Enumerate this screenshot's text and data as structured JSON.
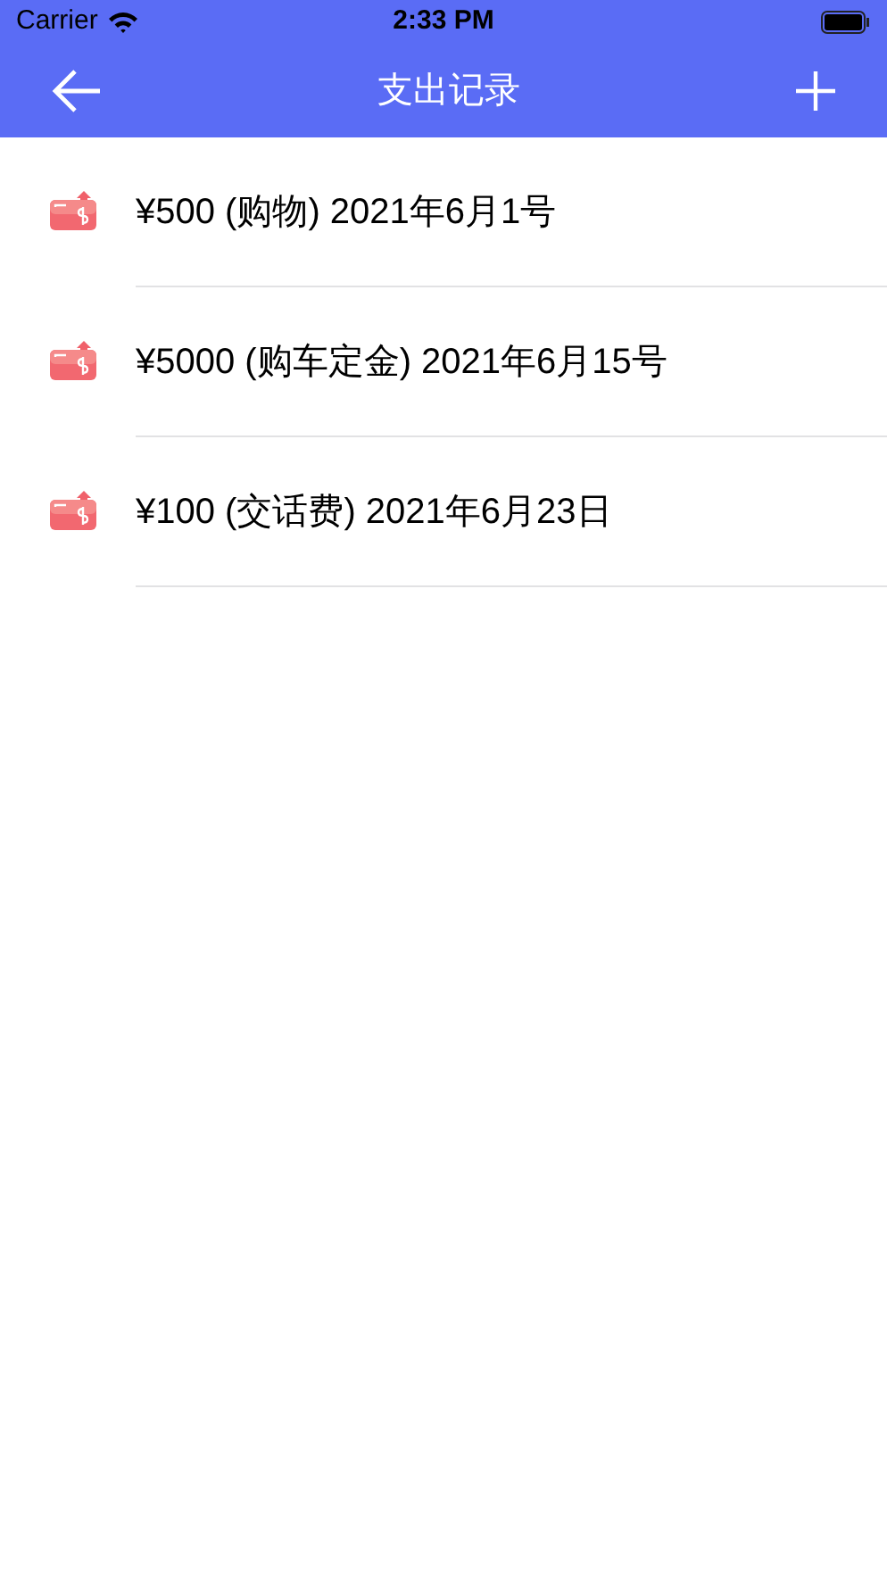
{
  "status_bar": {
    "carrier": "Carrier",
    "time": "2:33 PM"
  },
  "nav": {
    "title": "支出记录"
  },
  "records": [
    {
      "text": "¥500 (购物) 2021年6月1号"
    },
    {
      "text": "¥5000 (购车定金) 2021年6月15号"
    },
    {
      "text": "¥100 (交话费) 2021年6月23日"
    }
  ]
}
